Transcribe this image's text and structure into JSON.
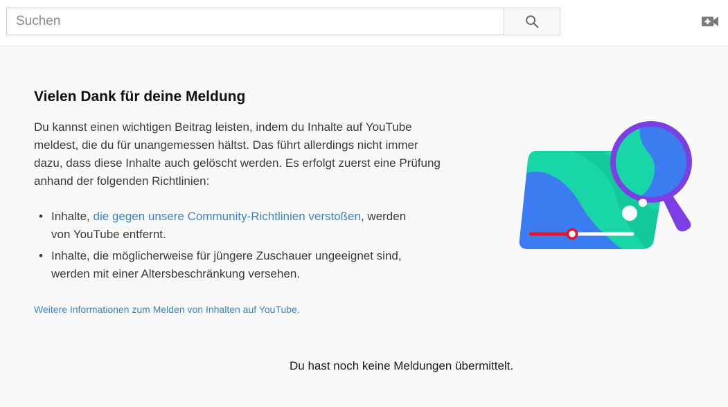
{
  "header": {
    "search_placeholder": "Suchen",
    "icons": {
      "search": "search-icon",
      "upload": "video-camera-plus-icon"
    }
  },
  "main": {
    "title": "Vielen Dank für deine Meldung",
    "intro": "Du kannst einen wichtigen Beitrag leisten, indem du Inhalte auf YouTube meldest, die du für unangemessen hältst. Das führt allerdings nicht immer dazu, dass diese Inhalte auch gelöscht werden. Es erfolgt zuerst eine Prüfung anhand der folgenden Richtlinien:",
    "bullets": [
      {
        "prefix": "Inhalte, ",
        "link": "die gegen unsere Community-Richtlinien verstoßen",
        "suffix": ", werden von YouTube entfernt."
      },
      {
        "text": "Inhalte, die möglicherweise für jüngere Zuschauer ungeeignet sind, werden mit einer Altersbeschränkung versehen."
      }
    ],
    "more_info_link": "Weitere Informationen zum Melden von Inhalten auf YouTube.",
    "empty_state": "Du hast noch keine Meldungen übermittelt."
  },
  "colors": {
    "link": "#3d83c4",
    "page_bg": "#f9f9f9",
    "accent_purple": "#7b3fe4",
    "accent_green": "#19d6a8",
    "accent_blue": "#3b7df0",
    "accent_red": "#e0162b"
  }
}
